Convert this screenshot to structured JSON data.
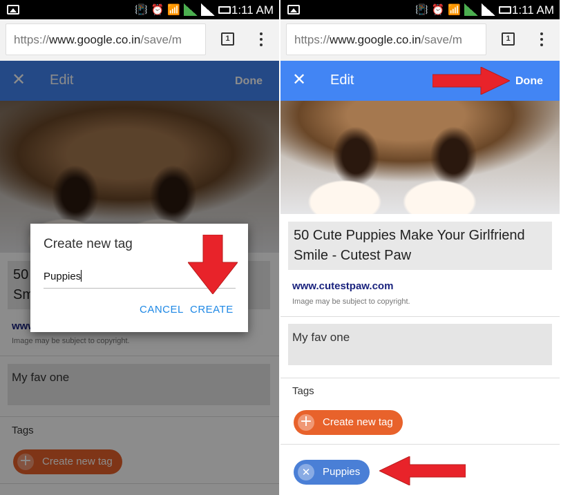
{
  "status": {
    "time": "1:11 AM"
  },
  "browser": {
    "url_prefix": "https://",
    "url_domain": "www.google.co.in",
    "url_path": "/save/m",
    "tab_count": "1"
  },
  "edit": {
    "close_glyph": "✕",
    "title": "Edit",
    "done": "Done",
    "page_title": "50 Cute Puppies Make Your Girlfriend Smile - Cutest Paw",
    "left_title_visible": "50\nSmi",
    "site": "www.cutestpaw.com",
    "left_site_visible": "www",
    "copyright": "Image may be subject to copyright.",
    "note": "My fav one",
    "tags_label": "Tags",
    "create_tag": "Create new tag",
    "new_tag": "Puppies",
    "plus_glyph": "+",
    "remove_glyph": "✕"
  },
  "dialog": {
    "title": "Create new tag",
    "input_value": "Puppies",
    "cancel": "CANCEL",
    "create": "CREATE"
  },
  "colors": {
    "appbar_active": "#4285f4",
    "appbar_dimmed": "#2c5593",
    "chip_orange": "#e8622b",
    "chip_blue": "#4a7fd6",
    "arrow_red": "#e8232a",
    "dialog_button": "#1e88e5"
  }
}
